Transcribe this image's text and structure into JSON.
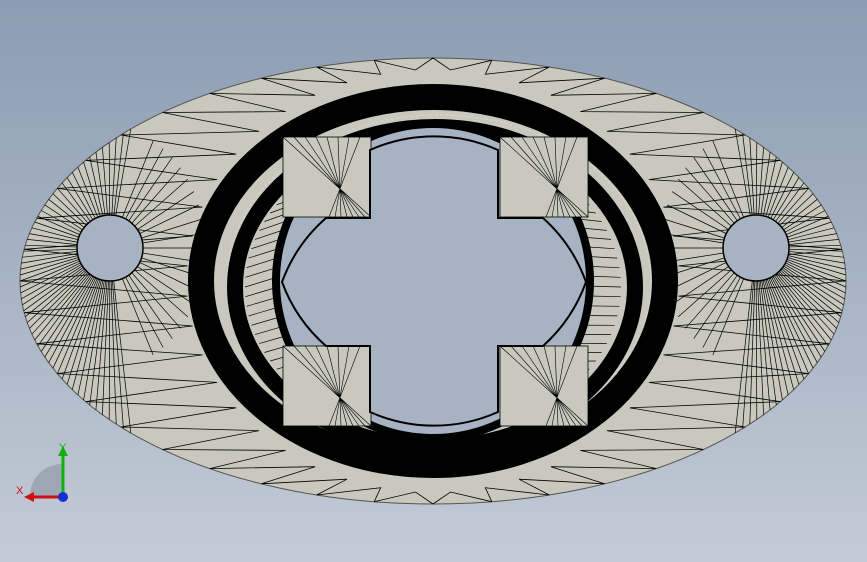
{
  "viewport": {
    "background_top": "#8c9cb2",
    "background_bottom": "#c3cbd6",
    "model": {
      "part": "oval-flange-with-lobed-bore",
      "display_mode": "shaded-with-mesh-edges",
      "face_color": "#c8c8be",
      "edge_color": "#000000",
      "mount_holes": 2,
      "bore_lobes": 4
    }
  },
  "triad": {
    "x_label": "X",
    "y_label": "Y",
    "x_color": "#d01010",
    "y_color": "#10b010",
    "z_color": "#1030d0"
  }
}
